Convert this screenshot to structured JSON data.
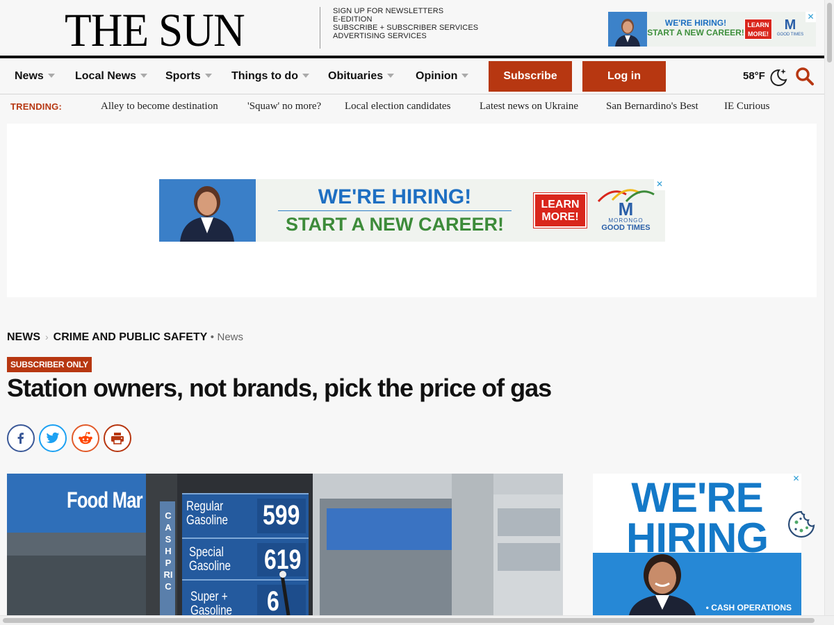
{
  "site": {
    "logo": "THE SUN"
  },
  "masthead_links": [
    "SIGN UP FOR NEWSLETTERS",
    "E-EDITION",
    "SUBSCRIBE + SUBSCRIBER SERVICES",
    "ADVERTISING SERVICES"
  ],
  "top_ad": {
    "line1": "WE'RE HIRING!",
    "line2": "START A NEW CAREER!",
    "cta": "LEARN MORE!",
    "brand": "M",
    "brand_sub": "GOOD TIMES",
    "close": "✕"
  },
  "nav": {
    "items": [
      "News",
      "Local News",
      "Sports",
      "Things to do",
      "Obituaries",
      "Opinion"
    ],
    "subscribe": "Subscribe",
    "login": "Log in",
    "weather": "58°F"
  },
  "trending": {
    "label": "TRENDING:",
    "links": [
      "Alley to become destination",
      "'Squaw' no more?",
      "Local election candidates",
      "Latest news on Ukraine",
      "San Bernardino's Best",
      "IE Curious"
    ]
  },
  "banner_ad": {
    "line1": "WE'RE HIRING!",
    "line2": "START A NEW CAREER!",
    "cta": "LEARN MORE!",
    "brand": "M",
    "brand_sub1": "MORONGO",
    "brand_sub2": "GOOD TIMES",
    "close": "✕"
  },
  "article": {
    "breadcrumb": {
      "section": "NEWS",
      "subsection": "CRIME AND PUBLIC SAFETY",
      "tag": "News"
    },
    "badge": "SUBSCRIBER ONLY",
    "headline": "Station owners, not brands, pick the price of gas"
  },
  "hero": {
    "store_sign": "Food Mar",
    "vertical_sign": "CASH PRIC",
    "price_rows": [
      {
        "grade": [
          "Regular",
          "Gasoline"
        ],
        "price": "599"
      },
      {
        "grade": [
          "Special",
          "Gasoline"
        ],
        "price": "619"
      },
      {
        "grade": [
          "Super +",
          "Gasoline"
        ],
        "price": "6"
      }
    ]
  },
  "side_ad": {
    "headline_1": "WE'RE",
    "headline_2": "HIRING",
    "footer": "• CASH OPERATIONS",
    "close": "✕"
  },
  "colors": {
    "brand_red": "#b73711",
    "facebook": "#3b5998",
    "twitter": "#1da1f2",
    "reddit": "#ff4500"
  }
}
